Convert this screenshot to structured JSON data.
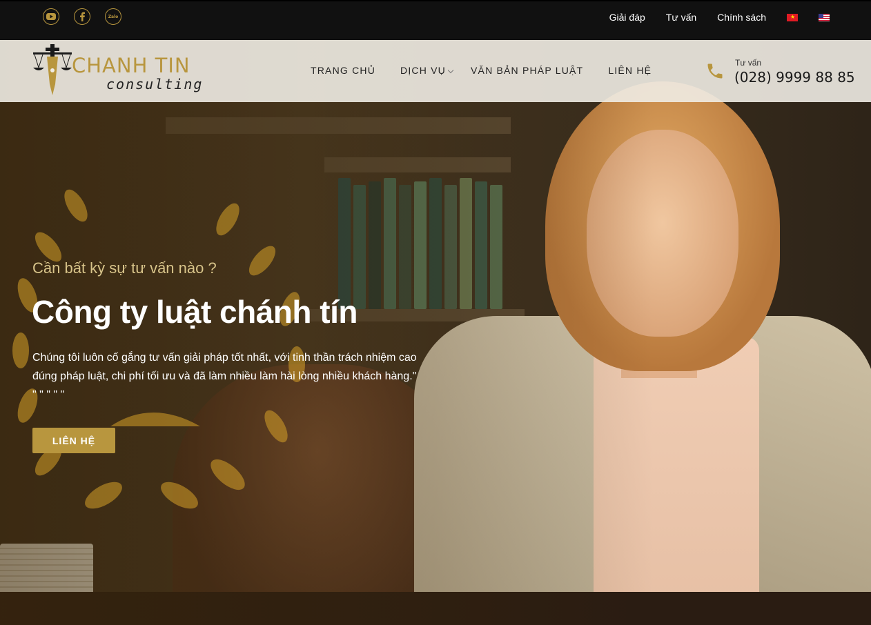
{
  "topbar": {
    "social": [
      {
        "icon": "youtube-icon"
      },
      {
        "icon": "facebook-icon"
      },
      {
        "icon": "zalo-icon",
        "text": "Zalo"
      }
    ],
    "links": [
      "Giải đáp",
      "Tư vấn",
      "Chính sách"
    ],
    "languages": [
      {
        "icon": "vietnam-flag-icon"
      },
      {
        "icon": "us-flag-icon"
      }
    ]
  },
  "brand": {
    "name": "CHANH TIN",
    "tagline": "consulting",
    "color": "#b8963e"
  },
  "nav": {
    "items": [
      "TRANG CHỦ",
      "DỊCH VỤ",
      "VĂN BẢN PHÁP LUẬT",
      "LIÊN HỆ"
    ]
  },
  "contact": {
    "label": "Tư vấn",
    "phone": "(028) 9999 88 85"
  },
  "hero": {
    "kicker": "Cần bất kỳ sự tư vấn nào ?",
    "title": "Công ty luật chánh tín",
    "description": "Chúng tôi luôn cố gắng tư vấn giải pháp tốt nhất, với tinh thần trách nhiệm cao đúng pháp luật, chi phí tối ưu và đã làm nhiều làm hài lòng nhiều khách hàng.\" \" \" \" \" \"",
    "cta_label": "LIÊN HỆ"
  }
}
